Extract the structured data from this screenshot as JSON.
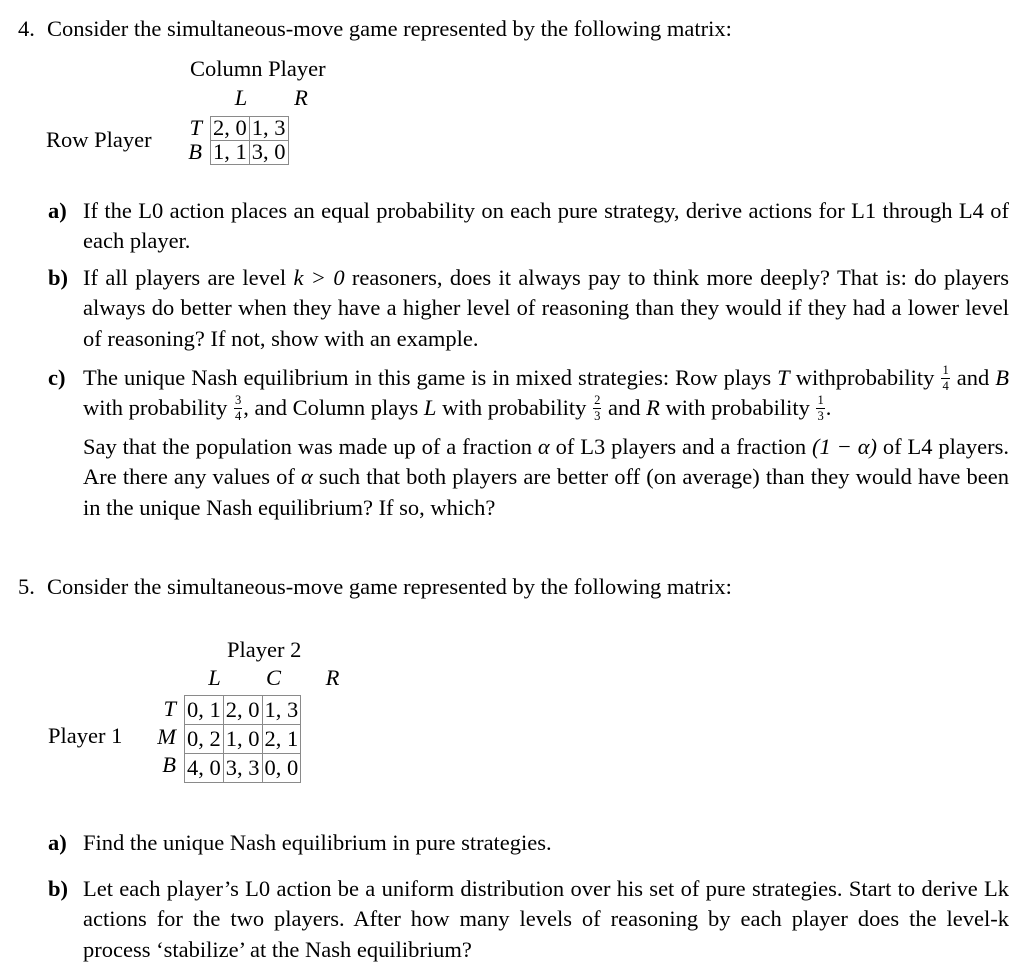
{
  "document": {
    "type": "problem-set",
    "problems": [
      {
        "number": "4.",
        "stem": "Consider the simultaneous-move game represented by the following matrix:",
        "matrix": {
          "column_player_title": "Column Player",
          "row_player_title": "Row Player",
          "column_labels": [
            "L",
            "R"
          ],
          "row_labels": [
            "T",
            "B"
          ],
          "cells": [
            [
              "2, 0",
              "1, 3"
            ],
            [
              "1, 1",
              "3, 0"
            ]
          ]
        },
        "parts": [
          {
            "letter": "a)",
            "paragraphs": [
              "If the L0 action places an equal probability on each pure strategy, derive actions for L1 through L4 of each player."
            ]
          },
          {
            "letter": "b)",
            "paragraphs": [
              "If all players are level k > 0 reasoners, does it always pay to think more deeply? That is: do players always do better when they have a higher level of reasoning than they would if they had a lower level of reasoning? If not, show with an example."
            ]
          },
          {
            "letter": "c)",
            "paragraphs": [
              "The unique Nash equilibrium in this game is in mixed strategies: Row plays T with probability 1/4 and B with probability 3/4, and Column plays L with probability 2/3 and R with probability 1/3.",
              "Say that the population was made up of a fraction α of L3 players and a fraction (1 − α) of L4 players. Are there any values of α such that both players are better off (on average) than they would have been in the unique Nash equilibrium? If so, which?"
            ],
            "math": {
              "row_T_prob": {
                "num": "1",
                "den": "4"
              },
              "row_B_prob": {
                "num": "3",
                "den": "4"
              },
              "col_L_prob": {
                "num": "2",
                "den": "3"
              },
              "col_R_prob": {
                "num": "1",
                "den": "3"
              },
              "alpha": "α",
              "one_minus_alpha": "(1 − α)",
              "k_condition": "k > 0",
              "strategy_T": "T",
              "strategy_B": "B",
              "strategy_L": "L",
              "strategy_R": "R"
            }
          }
        ]
      },
      {
        "number": "5.",
        "stem": "Consider the simultaneous-move game represented by the following matrix:",
        "matrix": {
          "column_player_title": "Player 2",
          "row_player_title": "Player 1",
          "column_labels": [
            "L",
            "C",
            "R"
          ],
          "row_labels": [
            "T",
            "M",
            "B"
          ],
          "cells": [
            [
              "0, 1",
              "2, 0",
              "1, 3"
            ],
            [
              "0, 2",
              "1, 0",
              "2, 1"
            ],
            [
              "4, 0",
              "3, 3",
              "0, 0"
            ]
          ]
        },
        "parts": [
          {
            "letter": "a)",
            "paragraphs": [
              "Find the unique Nash equilibrium in pure strategies."
            ]
          },
          {
            "letter": "b)",
            "paragraphs": [
              "Let each player’s L0 action be a uniform distribution over his set of pure strategies. Start to derive Lk actions for the two players. After how many levels of reasoning by each player does the level-k process ‘stabilize’ at the Nash equilibrium?"
            ]
          }
        ]
      }
    ]
  },
  "text_fragments": {
    "p4c_line1_a": "The unique Nash equilibrium in this game is in mixed strategies: Row plays ",
    "p4c_line1_b": " with",
    "p4c_line2_a": "probability ",
    "p4c_line2_b": " and ",
    "p4c_line2_c": " with probability ",
    "p4c_line2_d": ", and Column plays ",
    "p4c_line2_e": " with probability ",
    "p4c_line2_f": " and ",
    "p4c_line3_a": "with probability ",
    "p4c_line3_b": ".",
    "p4b_a": "If all players are level ",
    "p4b_b": " reasoners, does it always pay to think more deeply? That is: do players always do better when they have a higher level of reasoning than they would if they had a lower level of reasoning? If not, show with an example.",
    "p4c2_a": "Say that the population was made up of a fraction ",
    "p4c2_b": " of L3 players and a fraction ",
    "p4c2_c": " of L4 players. Are there any values of ",
    "p4c2_d": " such that both players are better off (on average) than they would have been in the unique Nash equilibrium? If so, which?"
  }
}
